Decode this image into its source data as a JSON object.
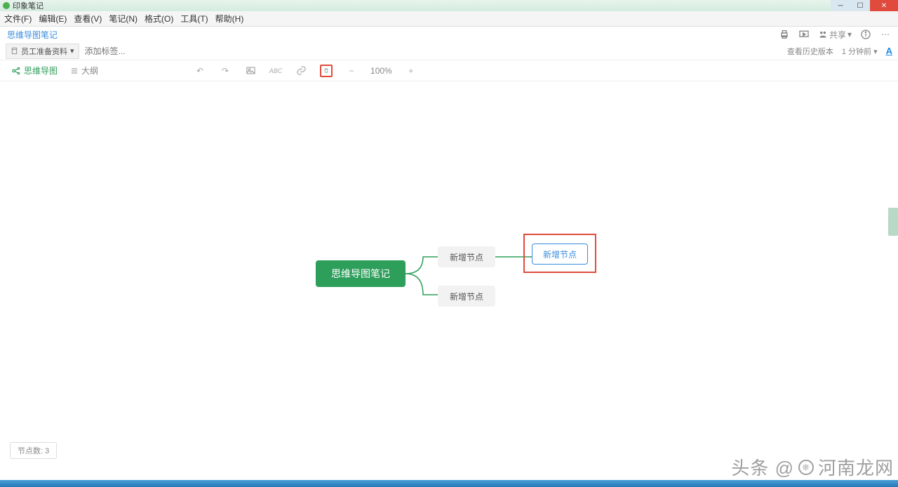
{
  "app": {
    "title": "印象笔记"
  },
  "menu": {
    "items": [
      {
        "label": "文件(F)"
      },
      {
        "label": "编辑(E)"
      },
      {
        "label": "查看(V)"
      },
      {
        "label": "笔记(N)"
      },
      {
        "label": "格式(O)"
      },
      {
        "label": "工具(T)"
      },
      {
        "label": "帮助(H)"
      }
    ]
  },
  "note": {
    "title": "思维导图笔记",
    "share_label": "共享"
  },
  "tags": {
    "notebook": "员工准备资料",
    "placeholder": "添加标签...",
    "history": "查看历史版本",
    "timestamp": "1 分钟前"
  },
  "toolbar": {
    "mindmap_tab": "思维导图",
    "outline_tab": "大纲",
    "zoom": "100%"
  },
  "mindmap": {
    "root": "思维导图笔记",
    "child1": "新增节点",
    "child2": "新增节点",
    "grandchild": "新增节点"
  },
  "status": {
    "node_count": "节点数: 3"
  },
  "watermark": {
    "prefix": "头条 @",
    "text": "河南龙网"
  }
}
